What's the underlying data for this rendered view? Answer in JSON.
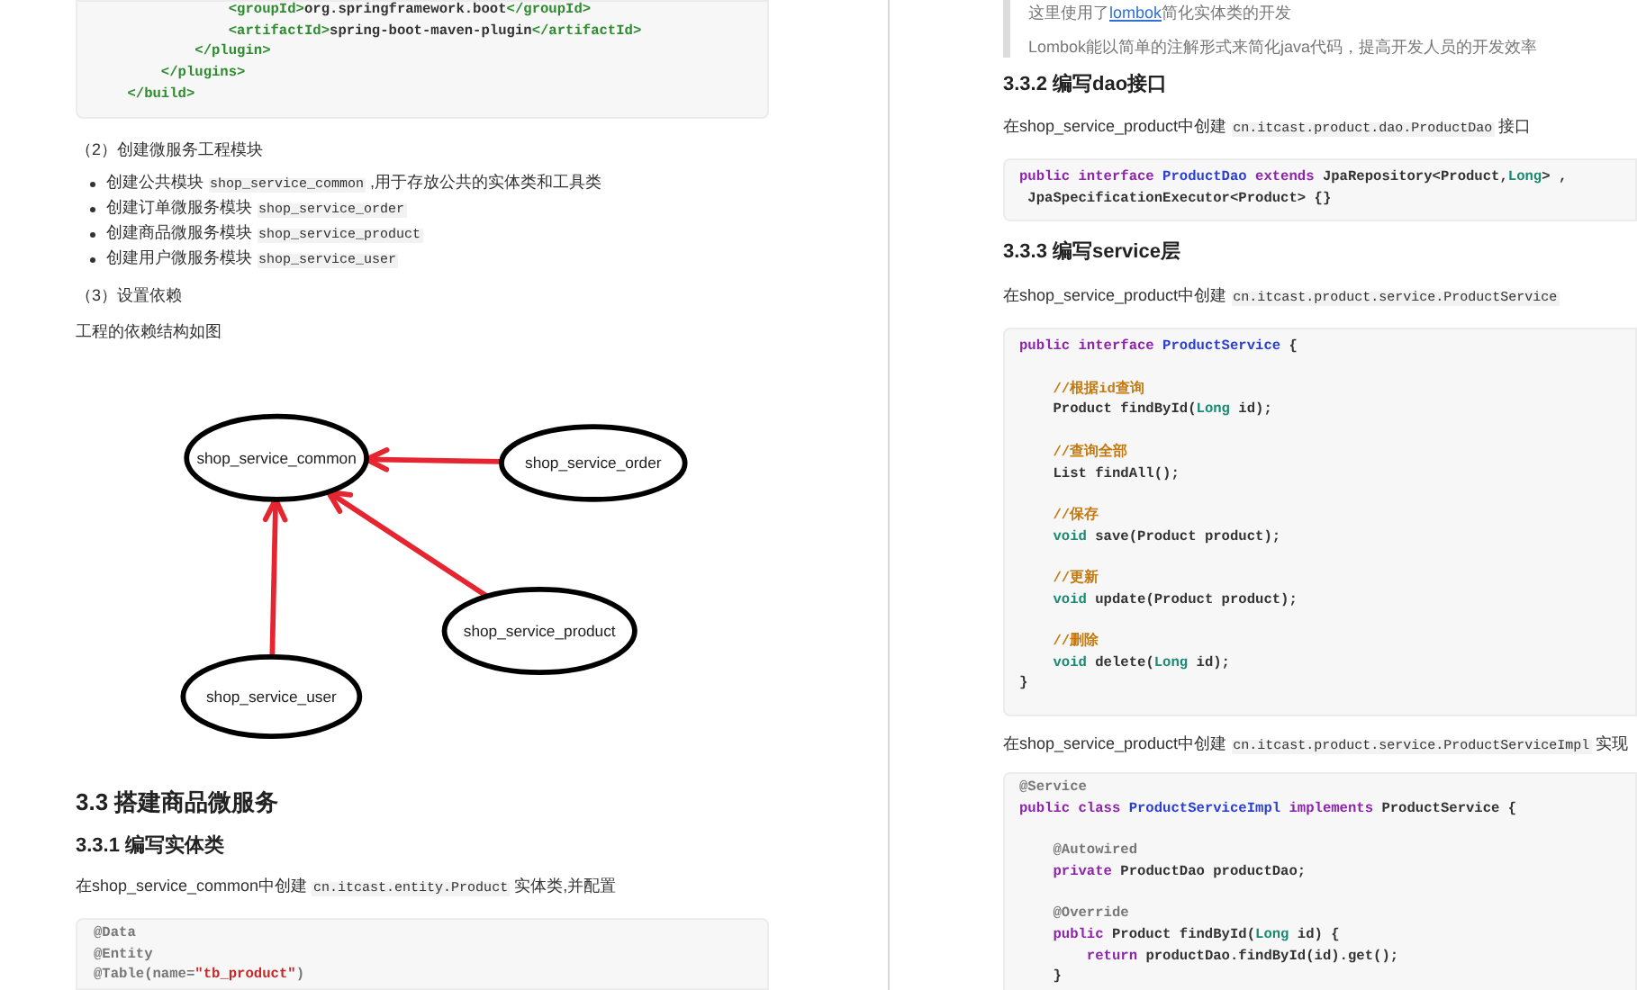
{
  "left_page": {
    "top_code": [
      {
        "kind": "code",
        "tokens": [
          {
            "text": "                <groupId>",
            "kind": "tag"
          },
          {
            "text": "org.springframework.boot",
            "kind": "plain"
          },
          {
            "text": "</groupId>",
            "kind": "tag"
          }
        ]
      },
      {
        "kind": "code",
        "tokens": [
          {
            "text": "                <artifactId>",
            "kind": "tag"
          },
          {
            "text": "spring-boot-maven-plugin",
            "kind": "plain"
          },
          {
            "text": "</artifactId>",
            "kind": "tag"
          }
        ]
      },
      {
        "kind": "code",
        "tokens": [
          {
            "text": "            </plugin>",
            "kind": "tag"
          }
        ]
      },
      {
        "kind": "code",
        "tokens": [
          {
            "text": "        </plugins>",
            "kind": "tag"
          }
        ]
      },
      {
        "kind": "code",
        "tokens": [
          {
            "text": "    </build>",
            "kind": "tag"
          }
        ]
      }
    ],
    "step2": {
      "parts": [
        {
          "text": "（2）创建微服务工程模块"
        }
      ]
    },
    "bullets": [
      {
        "parts": [
          {
            "text": "创建公共模块 "
          },
          {
            "text": "shop_service_common",
            "kind": "code"
          },
          {
            "text": " ,用于存放公共的实体类和工具类"
          }
        ]
      },
      {
        "parts": [
          {
            "text": "创建订单微服务模块 "
          },
          {
            "text": "shop_service_order",
            "kind": "code"
          }
        ]
      },
      {
        "parts": [
          {
            "text": "创建商品微服务模块 "
          },
          {
            "text": "shop_service_product",
            "kind": "code"
          }
        ]
      },
      {
        "parts": [
          {
            "text": "创建用户微服务模块 "
          },
          {
            "text": "shop_service_user",
            "kind": "code"
          }
        ]
      }
    ],
    "step3": {
      "parts": [
        {
          "text": "（3）设置依赖"
        }
      ]
    },
    "figure_caption": {
      "parts": [
        {
          "text": "工程的依赖结构如图"
        }
      ]
    },
    "diagram": {
      "nodes": [
        {
          "label": "shop_service_common",
          "arrow_to_first": false
        },
        {
          "label": "shop_service_order",
          "arrow_to_first": true
        },
        {
          "label": "shop_service_product",
          "arrow_to_first": true
        },
        {
          "label": "shop_service_user",
          "arrow_to_first": true
        }
      ]
    },
    "heading_3_3": "3.3 搭建商品微服务",
    "heading_3_3_1": "3.3.1 编写实体类",
    "entity_paragraph": {
      "parts": [
        {
          "text": "在shop_service_common中创建 "
        },
        {
          "text": "cn.itcast.entity.Product",
          "kind": "code"
        },
        {
          "text": " 实体类,并配置"
        }
      ]
    },
    "entity_code": [
      {
        "kind": "code",
        "tokens": [
          {
            "text": "@Data",
            "kind": "annotation"
          }
        ]
      },
      {
        "kind": "code",
        "tokens": [
          {
            "text": "@Entity",
            "kind": "annotation"
          }
        ]
      },
      {
        "kind": "code",
        "tokens": [
          {
            "text": "@Table(name=",
            "kind": "annotation"
          },
          {
            "text": "\"tb_product\"",
            "kind": "string"
          },
          {
            "text": ")",
            "kind": "annotation"
          }
        ]
      }
    ]
  },
  "right_page": {
    "quote": [
      {
        "parts": [
          {
            "text": "这里使用了"
          },
          {
            "text": "lombok",
            "kind": "link"
          },
          {
            "text": "简化实体类的开发"
          }
        ]
      },
      {
        "parts": [
          {
            "text": "Lombok能以简单的注解形式来简化java代码，提高开发人员的开发效率"
          }
        ]
      }
    ],
    "heading_3_3_2": "3.3.2 编写dao接口",
    "dao_paragraph": {
      "parts": [
        {
          "text": "在shop_service_product中创建 "
        },
        {
          "text": "cn.itcast.product.dao.ProductDao",
          "kind": "code"
        },
        {
          "text": " 接口"
        }
      ]
    },
    "dao_code": [
      {
        "kind": "code",
        "tokens": [
          {
            "text": "public interface ",
            "kind": "keyword"
          },
          {
            "text": "ProductDao ",
            "kind": "name"
          },
          {
            "text": "extends ",
            "kind": "keyword"
          },
          {
            "text": "JpaRepository<Product,",
            "kind": "plain"
          },
          {
            "text": "Long",
            "kind": "type"
          },
          {
            "text": "> ,",
            "kind": "plain"
          }
        ]
      },
      {
        "kind": "code",
        "tokens": [
          {
            "text": " JpaSpecificationExecutor<Product> {}",
            "kind": "plain"
          }
        ]
      }
    ],
    "heading_3_3_3": "3.3.3 编写service层",
    "service_paragraph": {
      "parts": [
        {
          "text": "在shop_service_product中创建 "
        },
        {
          "text": "cn.itcast.product.service.ProductService",
          "kind": "code"
        }
      ]
    },
    "service_code": [
      {
        "kind": "code",
        "tokens": [
          {
            "text": "public interface ",
            "kind": "keyword"
          },
          {
            "text": "ProductService ",
            "kind": "name"
          },
          {
            "text": "{",
            "kind": "plain"
          }
        ]
      },
      {
        "kind": "blank"
      },
      {
        "kind": "code",
        "tokens": [
          {
            "text": "    //根据id查询",
            "kind": "comment"
          }
        ]
      },
      {
        "kind": "code",
        "tokens": [
          {
            "text": "    Product findById(",
            "kind": "plain"
          },
          {
            "text": "Long",
            "kind": "type"
          },
          {
            "text": " id);",
            "kind": "plain"
          }
        ]
      },
      {
        "kind": "blank"
      },
      {
        "kind": "code",
        "tokens": [
          {
            "text": "    //查询全部",
            "kind": "comment"
          }
        ]
      },
      {
        "kind": "code",
        "tokens": [
          {
            "text": "    List findAll();",
            "kind": "plain"
          }
        ]
      },
      {
        "kind": "blank"
      },
      {
        "kind": "code",
        "tokens": [
          {
            "text": "    //保存",
            "kind": "comment"
          }
        ]
      },
      {
        "kind": "code",
        "tokens": [
          {
            "text": "    void",
            "kind": "type"
          },
          {
            "text": " save(Product product);",
            "kind": "plain"
          }
        ]
      },
      {
        "kind": "blank"
      },
      {
        "kind": "code",
        "tokens": [
          {
            "text": "    //更新",
            "kind": "comment"
          }
        ]
      },
      {
        "kind": "code",
        "tokens": [
          {
            "text": "    void",
            "kind": "type"
          },
          {
            "text": " update(Product product);",
            "kind": "plain"
          }
        ]
      },
      {
        "kind": "blank"
      },
      {
        "kind": "code",
        "tokens": [
          {
            "text": "    //删除",
            "kind": "comment"
          }
        ]
      },
      {
        "kind": "code",
        "tokens": [
          {
            "text": "    void",
            "kind": "type"
          },
          {
            "text": " delete(",
            "kind": "plain"
          },
          {
            "text": "Long",
            "kind": "type"
          },
          {
            "text": " id);",
            "kind": "plain"
          }
        ]
      },
      {
        "kind": "code",
        "tokens": [
          {
            "text": "}",
            "kind": "plain"
          }
        ]
      }
    ],
    "impl_paragraph": {
      "parts": [
        {
          "text": "在shop_service_product中创建 "
        },
        {
          "text": "cn.itcast.product.service.ProductServiceImpl",
          "kind": "code"
        },
        {
          "text": " 实现"
        }
      ]
    },
    "impl_code": [
      {
        "kind": "code",
        "tokens": [
          {
            "text": "@Service",
            "kind": "annotation"
          }
        ]
      },
      {
        "kind": "code",
        "tokens": [
          {
            "text": "public class ",
            "kind": "keyword"
          },
          {
            "text": "ProductServiceImpl ",
            "kind": "name"
          },
          {
            "text": "implements ",
            "kind": "keyword"
          },
          {
            "text": "ProductService {",
            "kind": "plain"
          }
        ]
      },
      {
        "kind": "blank"
      },
      {
        "kind": "code",
        "tokens": [
          {
            "text": "    @Autowired",
            "kind": "annotation"
          }
        ]
      },
      {
        "kind": "code",
        "tokens": [
          {
            "text": "    private ",
            "kind": "keyword"
          },
          {
            "text": "ProductDao productDao;",
            "kind": "plain"
          }
        ]
      },
      {
        "kind": "blank"
      },
      {
        "kind": "code",
        "tokens": [
          {
            "text": "    @Override",
            "kind": "annotation"
          }
        ]
      },
      {
        "kind": "code",
        "tokens": [
          {
            "text": "    public ",
            "kind": "keyword"
          },
          {
            "text": "Product findById(",
            "kind": "plain"
          },
          {
            "text": "Long",
            "kind": "type"
          },
          {
            "text": " id) {",
            "kind": "plain"
          }
        ]
      },
      {
        "kind": "code",
        "tokens": [
          {
            "text": "        return ",
            "kind": "keyword"
          },
          {
            "text": "productDao.findById(id).get();",
            "kind": "plain"
          }
        ]
      },
      {
        "kind": "code",
        "tokens": [
          {
            "text": "    }",
            "kind": "plain"
          }
        ]
      }
    ]
  }
}
